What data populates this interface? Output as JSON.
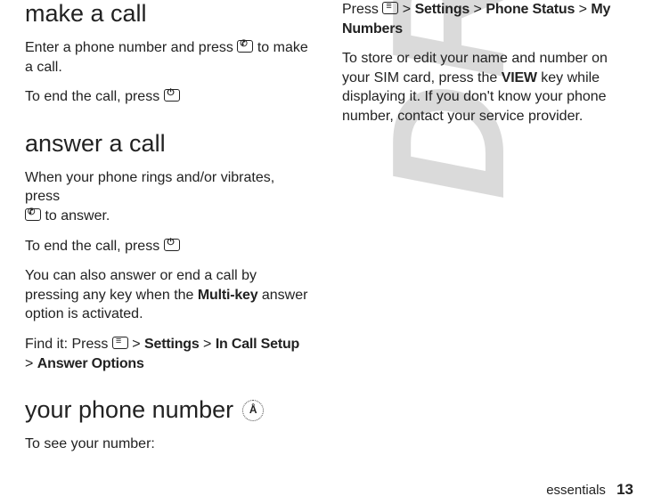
{
  "watermark": "DRAFT",
  "left": {
    "h_make": "make a call",
    "p_make_1a": "Enter a phone number and press ",
    "p_make_1b": " to make a call.",
    "p_make_2a": "To end the call, press ",
    "h_answer": "answer a call",
    "p_ans_1a": "When your phone rings and/or vibrates, press ",
    "p_ans_1b": " to answer.",
    "p_ans_2a": "To end the call, press ",
    "p_ans_3a": "You can also answer or end a call by pressing any key when the ",
    "p_ans_3_bold": "Multi-key",
    "p_ans_3b": " answer option is activated.",
    "findit_label": "Find it:",
    "findit_press": " Press ",
    "findit_sep": " > ",
    "findit_settings": "Settings",
    "findit_incall": "In Call Setup",
    "findit_answeropt": "Answer Options",
    "h_number": "your phone number",
    "circ_a": "Å",
    "p_num_1": "To see your number:"
  },
  "right": {
    "p_r1a": "Press ",
    "p_r1_sep": " > ",
    "p_r1_settings": "Settings",
    "p_r1_phonestatus": "Phone Status",
    "p_r1_mynumbers": "My Numbers",
    "p_r2a": "To store or edit your name and number on your SIM card, press the ",
    "p_r2_bold": "VIEW",
    "p_r2b": " key while displaying it. If you don't know your phone number, contact your service provider."
  },
  "footer": {
    "section": "essentials",
    "page": "13"
  }
}
